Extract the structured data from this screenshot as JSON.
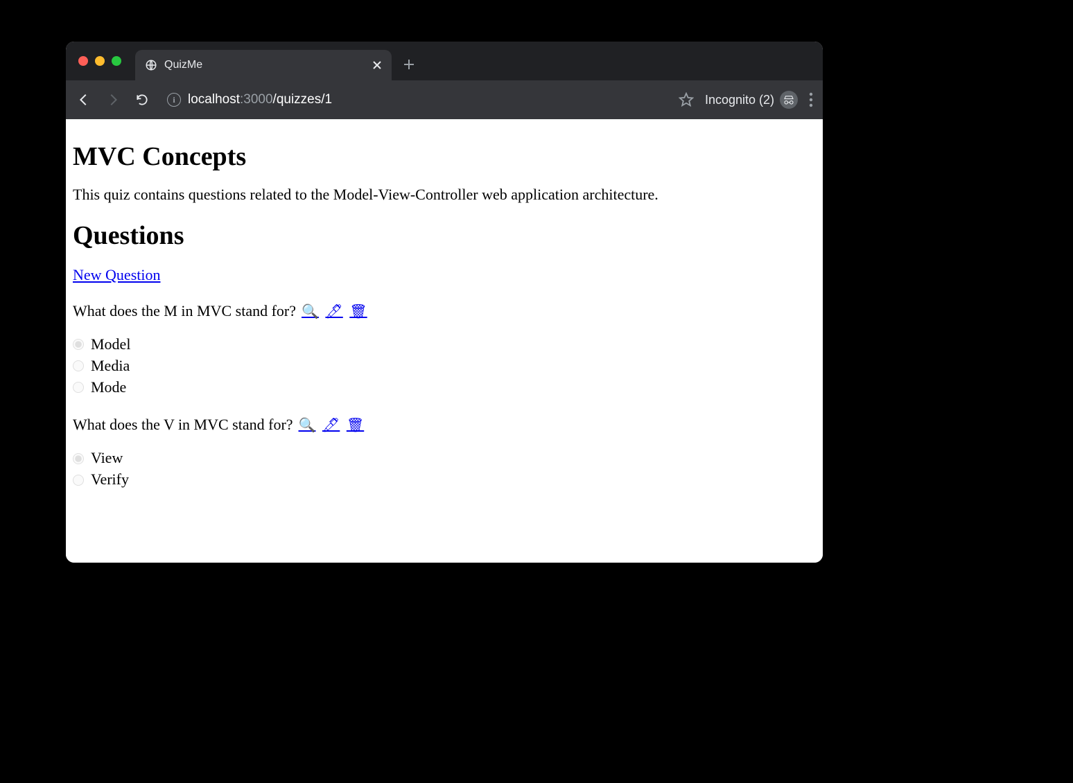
{
  "browser": {
    "tab_title": "QuizMe",
    "url_host": "localhost",
    "url_port": ":3000",
    "url_path": "/quizzes/1",
    "incognito_label": "Incognito (2)"
  },
  "page": {
    "title": "MVC Concepts",
    "description": "This quiz contains questions related to the Model-View-Controller web application architecture.",
    "questions_heading": "Questions",
    "new_question_link": "New Question",
    "questions": [
      {
        "text": "What does the M in MVC stand for?",
        "actions": {
          "view": "🔍",
          "edit": "🖊",
          "delete": "🗑"
        },
        "choices": [
          {
            "label": "Model",
            "selected": true
          },
          {
            "label": "Media",
            "selected": false
          },
          {
            "label": "Mode",
            "selected": false
          }
        ]
      },
      {
        "text": "What does the V in MVC stand for?",
        "actions": {
          "view": "🔍",
          "edit": "🖊",
          "delete": "🗑"
        },
        "choices": [
          {
            "label": "View",
            "selected": true
          },
          {
            "label": "Verify",
            "selected": false
          }
        ]
      }
    ]
  }
}
